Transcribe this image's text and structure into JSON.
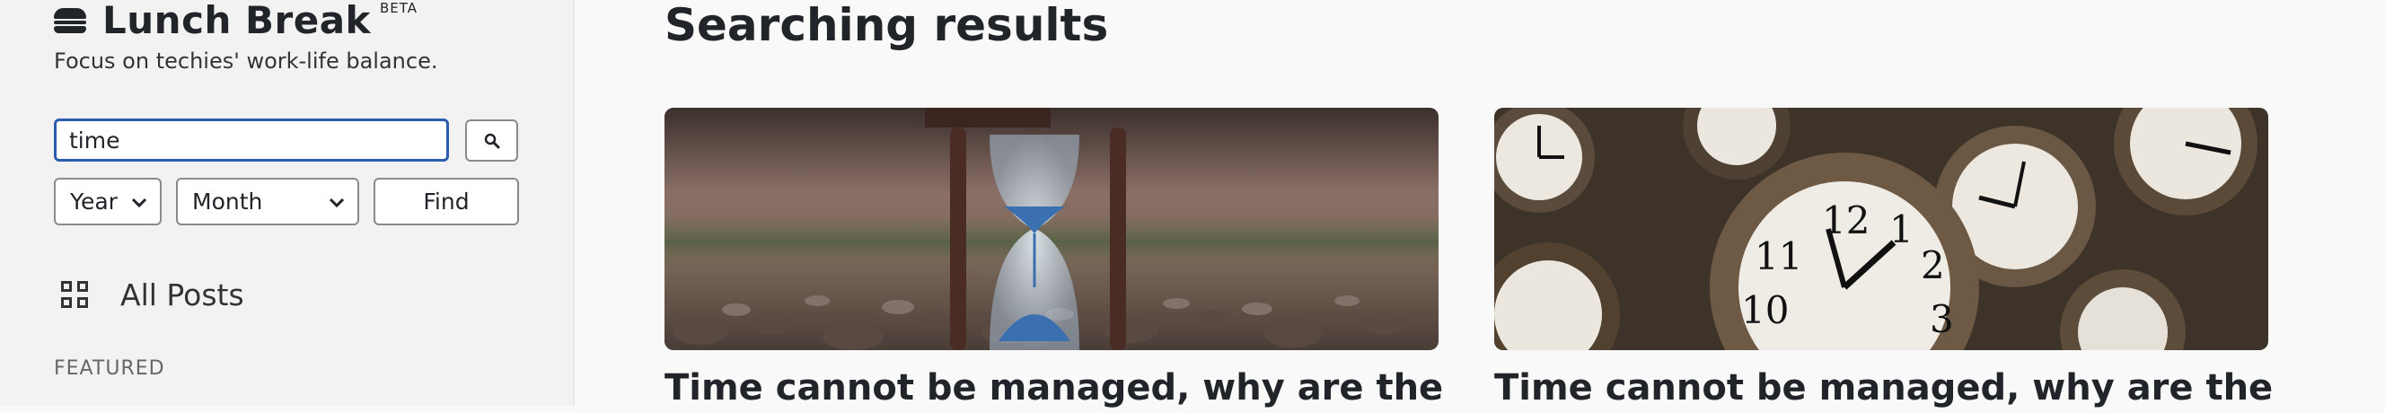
{
  "brand": {
    "title": "Lunch Break",
    "badge": "BETA",
    "tagline": "Focus on techies' work-life balance.",
    "icon": "burger-icon"
  },
  "search": {
    "value": "time",
    "button_icon": "search-icon"
  },
  "filters": {
    "year": "Year",
    "month": "Month",
    "find_label": "Find"
  },
  "nav": {
    "all_posts": "All Posts",
    "all_posts_icon": "grid-icon",
    "featured_heading": "FEATURED"
  },
  "main": {
    "title": "Searching results",
    "cards": [
      {
        "title": "Time cannot be managed, why are the",
        "image": "hourglass-photo"
      },
      {
        "title": "Time cannot be managed, why are the",
        "image": "vintage-clocks-photo"
      }
    ]
  },
  "colors": {
    "accent": "#2a5db0",
    "sidebar_bg": "#f2f2f2",
    "page_bg": "#f9f9f9"
  }
}
